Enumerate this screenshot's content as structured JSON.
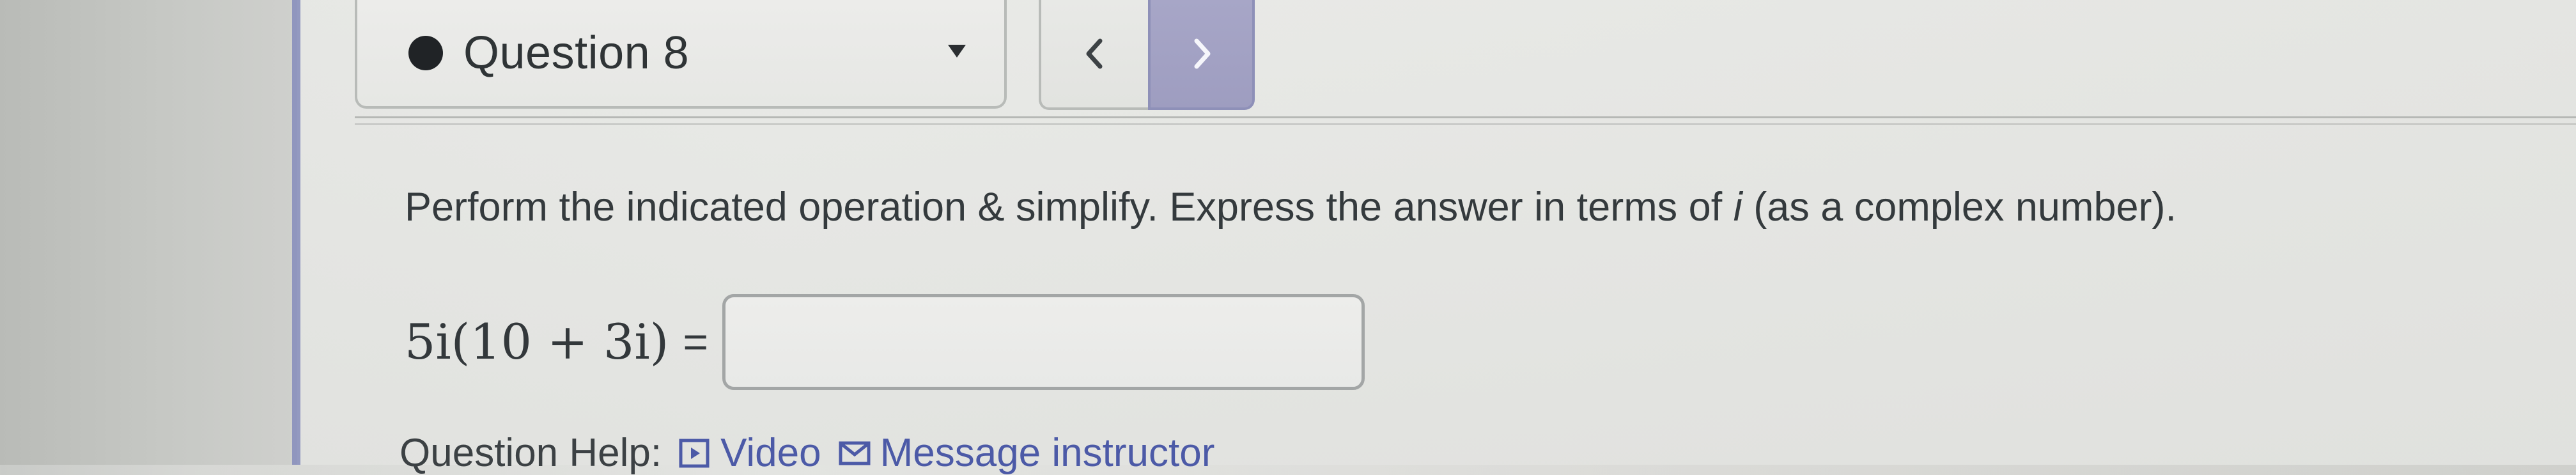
{
  "question_nav": {
    "label": "Question 8",
    "dropdown_icon": "chevron-down-icon",
    "prev_icon": "chevron-left-icon",
    "next_icon": "chevron-right-icon"
  },
  "problem": {
    "instruction_prefix": "Perform the indicated operation & simplify. Express the answer in terms of ",
    "instruction_var": "i",
    "instruction_suffix": " (as a complex number).",
    "equation": "5i(10 + 3i)",
    "equals": "=",
    "answer_value": "",
    "answer_placeholder": ""
  },
  "help": {
    "label": "Question Help:",
    "video_label": "Video",
    "message_label": "Message instructor",
    "video_icon": "video-icon",
    "message_icon": "mail-icon"
  },
  "colors": {
    "accent_next": "#9e9dc0",
    "link": "#4c5aa7",
    "question_dot": "#202326"
  }
}
